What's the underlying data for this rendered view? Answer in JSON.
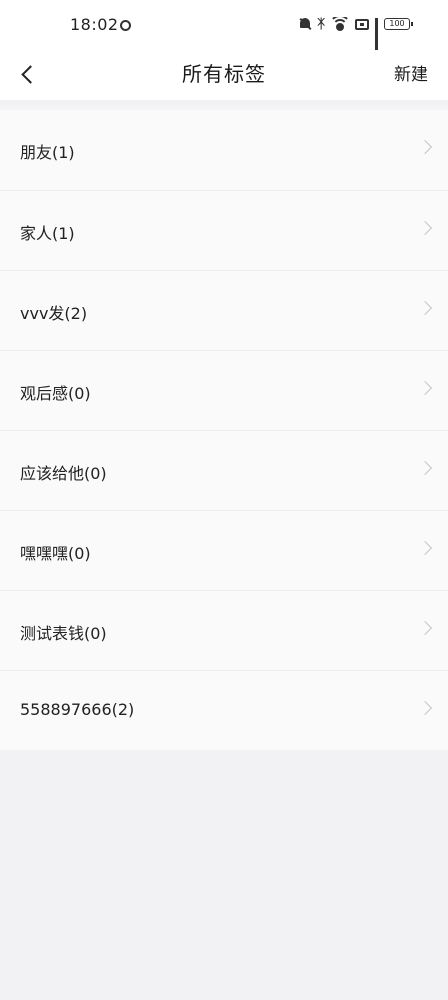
{
  "status_bar": {
    "time": "18:02",
    "battery": "100"
  },
  "nav": {
    "title": "所有标签",
    "new_label": "新建"
  },
  "tags": [
    {
      "label": "朋友(1)"
    },
    {
      "label": "家人(1)"
    },
    {
      "label": "vvv发(2)"
    },
    {
      "label": "观后感(0)"
    },
    {
      "label": "应该给他(0)"
    },
    {
      "label": "嘿嘿嘿(0)"
    },
    {
      "label": "测试表钱(0)"
    },
    {
      "label": "558897666(2)"
    }
  ]
}
